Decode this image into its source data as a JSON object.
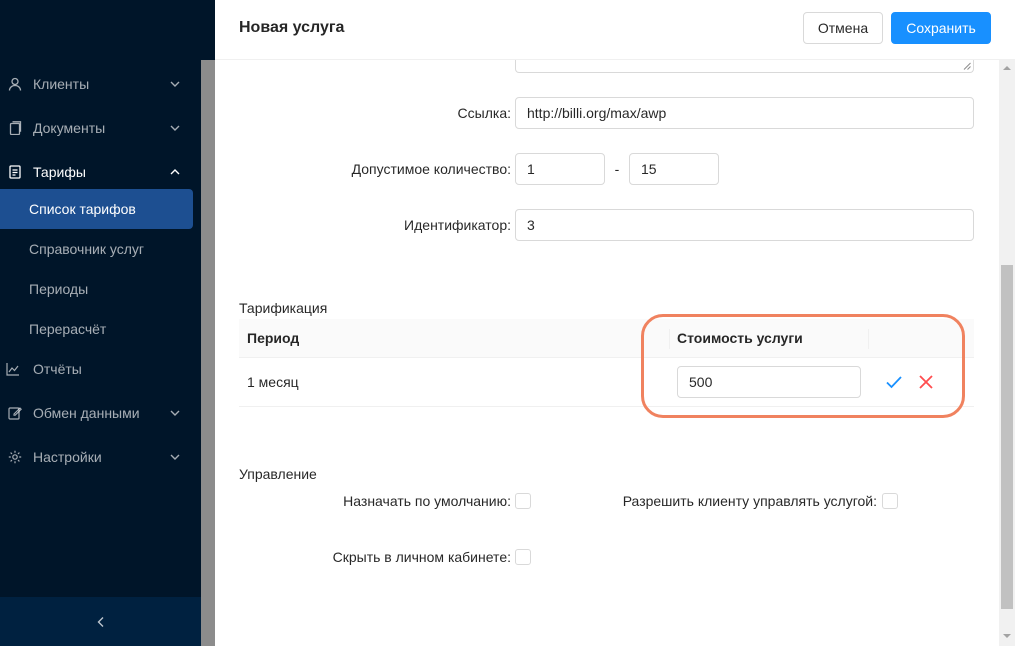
{
  "sidebar": {
    "items": [
      {
        "label": "Клиенты",
        "icon": "user-icon",
        "chevron": "down"
      },
      {
        "label": "Документы",
        "icon": "document-icon",
        "chevron": "down"
      },
      {
        "label": "Тарифы",
        "icon": "file-text-icon",
        "chevron": "up"
      }
    ],
    "subitems": [
      {
        "label": "Список тарифов",
        "active": true
      },
      {
        "label": "Справочник услуг",
        "active": false
      },
      {
        "label": "Периоды",
        "active": false
      },
      {
        "label": "Перерасчёт",
        "active": false
      }
    ],
    "items_after": [
      {
        "label": "Отчёты",
        "icon": "line-chart-icon",
        "chevron": ""
      },
      {
        "label": "Обмен данными",
        "icon": "edit-icon",
        "chevron": "down"
      },
      {
        "label": "Настройки",
        "icon": "gear-icon",
        "chevron": "down"
      }
    ],
    "collapse_icon": "chevron-left-icon"
  },
  "drawer": {
    "title": "Новая услуга",
    "cancel_label": "Отмена",
    "save_label": "Сохранить"
  },
  "form": {
    "link_label": "Ссылка",
    "link_value": "http://billi.org/max/awp",
    "qty_label": "Допустимое количество",
    "qty_min": "1",
    "qty_sep": "-",
    "qty_max": "15",
    "id_label": "Идентификатор",
    "id_value": "3",
    "colon": ":"
  },
  "tariffication": {
    "title": "Тарификация",
    "col_period": "Период",
    "col_cost": "Стоимость услуги",
    "rows": [
      {
        "period": "1 месяц",
        "cost": "500"
      }
    ]
  },
  "management": {
    "title": "Управление",
    "default_label": "Назначать по умолчанию",
    "allow_client_label": "Разрешить клиенту управлять услугой",
    "hide_label": "Скрыть в личном кабинете"
  },
  "colors": {
    "sidebar_bg": "#001529",
    "active_item": "#1d4f91",
    "primary": "#1890ff",
    "highlight": "#f0825f",
    "danger": "#ff4d4f"
  }
}
